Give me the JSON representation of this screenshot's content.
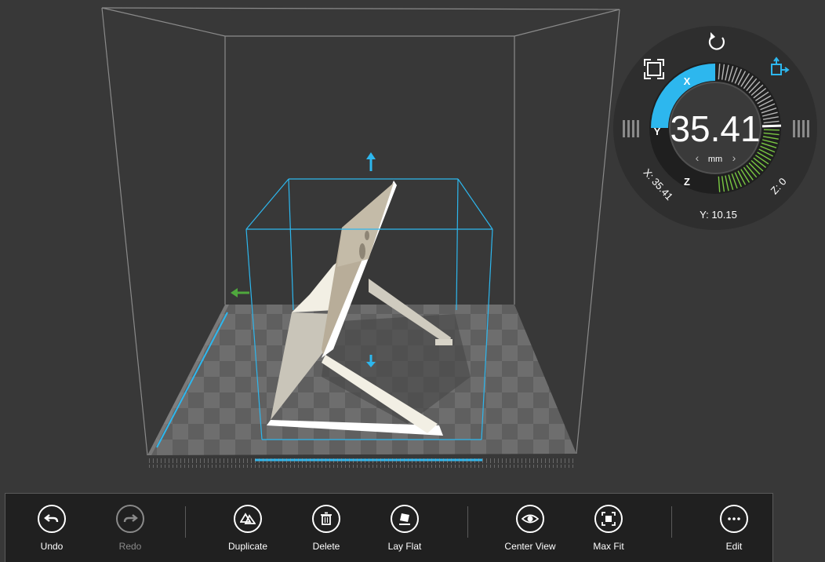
{
  "dial": {
    "value": "35.41",
    "unit": "mm",
    "x_label": "X",
    "y_label": "Y",
    "z_label": "Z",
    "x_readout": "X: 35.41",
    "y_readout": "Y: 10.15",
    "z_readout": "Z: 0",
    "prev_unit": "‹",
    "next_unit": "›",
    "x_fill_fraction": 0.5,
    "accent_color": "#2db7ee",
    "green_color": "#7ac943"
  },
  "toolbar": {
    "undo": "Undo",
    "redo": "Redo",
    "duplicate": "Duplicate",
    "delete": "Delete",
    "lay_flat": "Lay Flat",
    "center_view": "Center View",
    "max_fit": "Max Fit",
    "edit": "Edit"
  },
  "colors": {
    "background": "#383838",
    "bounding_box": "#2db7ee",
    "model": "#e8e4d8",
    "x_arrow": "#4fa83d"
  }
}
